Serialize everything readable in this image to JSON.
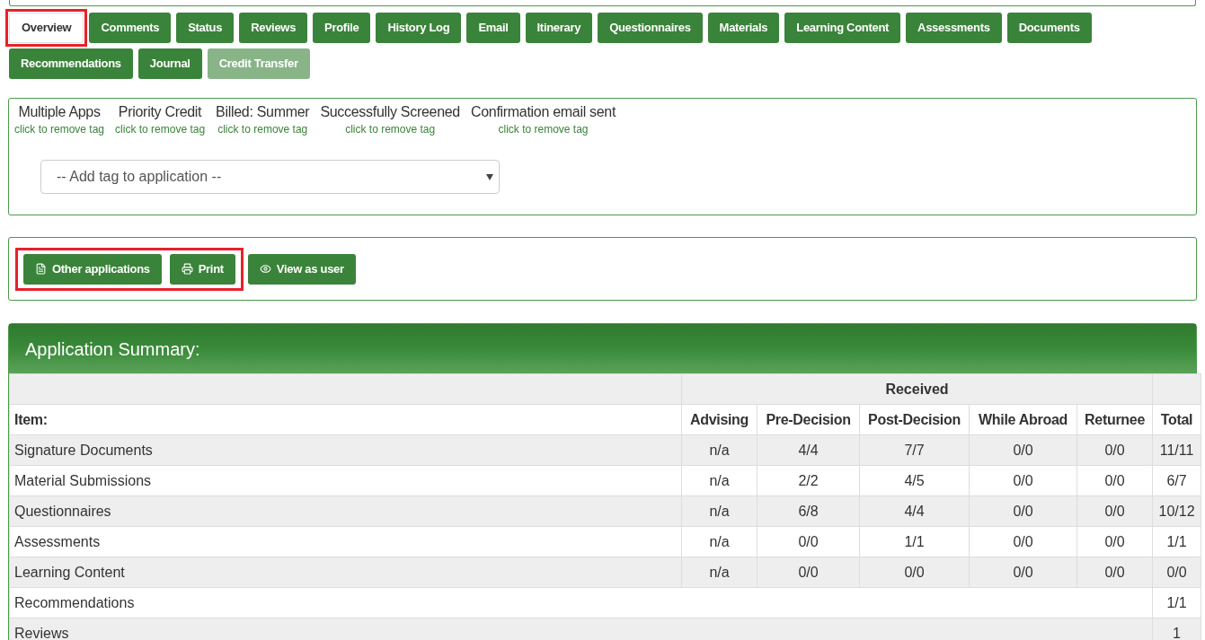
{
  "tabs": [
    {
      "label": "Overview",
      "selected": true,
      "disabled": false,
      "highlighted": true
    },
    {
      "label": "Comments",
      "selected": false,
      "disabled": false,
      "highlighted": false
    },
    {
      "label": "Status",
      "selected": false,
      "disabled": false,
      "highlighted": false
    },
    {
      "label": "Reviews",
      "selected": false,
      "disabled": false,
      "highlighted": false
    },
    {
      "label": "Profile",
      "selected": false,
      "disabled": false,
      "highlighted": false
    },
    {
      "label": "History Log",
      "selected": false,
      "disabled": false,
      "highlighted": false
    },
    {
      "label": "Email",
      "selected": false,
      "disabled": false,
      "highlighted": false
    },
    {
      "label": "Itinerary",
      "selected": false,
      "disabled": false,
      "highlighted": false
    },
    {
      "label": "Questionnaires",
      "selected": false,
      "disabled": false,
      "highlighted": false
    },
    {
      "label": "Materials",
      "selected": false,
      "disabled": false,
      "highlighted": false
    },
    {
      "label": "Learning Content",
      "selected": false,
      "disabled": false,
      "highlighted": false
    },
    {
      "label": "Assessments",
      "selected": false,
      "disabled": false,
      "highlighted": false
    },
    {
      "label": "Documents",
      "selected": false,
      "disabled": false,
      "highlighted": false
    },
    {
      "label": "Recommendations",
      "selected": false,
      "disabled": false,
      "highlighted": false
    },
    {
      "label": "Journal",
      "selected": false,
      "disabled": false,
      "highlighted": false
    },
    {
      "label": "Credit Transfer",
      "selected": false,
      "disabled": true,
      "highlighted": false
    }
  ],
  "tags": [
    {
      "name": "Multiple Apps",
      "remove": "click to remove tag"
    },
    {
      "name": "Priority Credit",
      "remove": "click to remove tag"
    },
    {
      "name": "Billed: Summer",
      "remove": "click to remove tag"
    },
    {
      "name": "Successfully Screened",
      "remove": "click to remove tag"
    },
    {
      "name": "Confirmation email sent",
      "remove": "click to remove tag"
    }
  ],
  "tag_select": {
    "value": "-- Add tag to application --"
  },
  "actions": [
    {
      "label": "Other applications",
      "kind": "document",
      "highlighted": true
    },
    {
      "label": "Print",
      "kind": "print",
      "highlighted": true
    },
    {
      "label": "View as user",
      "kind": "view",
      "highlighted": false
    }
  ],
  "summary": {
    "title": "Application Summary:",
    "group_header": "Received",
    "columns": [
      "Item:",
      "Advising",
      "Pre-Decision",
      "Post-Decision",
      "While Abroad",
      "Returnee",
      "Total"
    ],
    "rows": [
      {
        "kind": "staged",
        "cells": [
          "Signature Documents",
          "n/a",
          "4/4",
          "7/7",
          "0/0",
          "0/0",
          "11/11"
        ]
      },
      {
        "kind": "staged",
        "cells": [
          "Material Submissions",
          "n/a",
          "2/2",
          "4/5",
          "0/0",
          "0/0",
          "6/7"
        ]
      },
      {
        "kind": "staged",
        "cells": [
          "Questionnaires",
          "n/a",
          "6/8",
          "4/4",
          "0/0",
          "0/0",
          "10/12"
        ]
      },
      {
        "kind": "staged",
        "cells": [
          "Assessments",
          "n/a",
          "0/0",
          "1/1",
          "0/0",
          "0/0",
          "1/1"
        ]
      },
      {
        "kind": "staged",
        "cells": [
          "Learning Content",
          "n/a",
          "0/0",
          "0/0",
          "0/0",
          "0/0",
          "0/0"
        ]
      },
      {
        "kind": "total_only",
        "cells": [
          {
            "text": "Recommendations",
            "colspan": 6
          },
          {
            "text": "1/1"
          }
        ]
      },
      {
        "kind": "total_only",
        "cells": [
          {
            "text": "Reviews",
            "colspan": 6
          },
          {
            "text": "1"
          }
        ]
      }
    ]
  }
}
